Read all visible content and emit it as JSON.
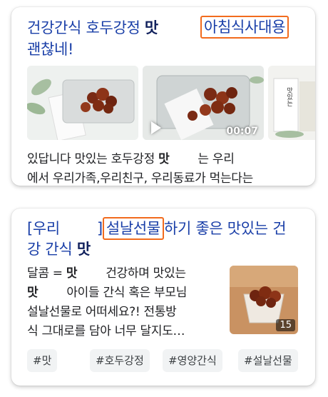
{
  "card1": {
    "title_pre": "건강간식 호두강정 ",
    "title_bold": "맛",
    "title_highlight": "아침식사대용",
    "title_line2": "괜찮네!",
    "video_duration": "00:07",
    "thumb3_text": "맛있는",
    "body_line1_a": "있답니다 맛있는 호두강정 ",
    "body_line1_bold": "맛",
    "body_line1_b": "는 우리",
    "body_line2": "에서 우리가족,우리친구, 우리동료가 먹는다는"
  },
  "card2": {
    "title_a": "[우리",
    "title_b": "]",
    "title_highlight": "설날선물",
    "title_c": "하기 좋은 맛있는 건",
    "title_line2": "강 간식 ",
    "title_bold": "맛",
    "body_line1_a": "달콤 = ",
    "body_line1_bold": "맛",
    "body_line1_b": "건강하며 맛있는",
    "body_line2_bold": "맛",
    "body_line2_b": "아이들 간식 혹은 부모님",
    "body_line3": "설날선물로 어떠세요?! 전통방",
    "body_line4": "식 그대로를 담아 너무 달지도…",
    "image_count": "15",
    "tags": [
      "#맛",
      "#호두강정",
      "#영양간식",
      "#설날선물"
    ]
  }
}
